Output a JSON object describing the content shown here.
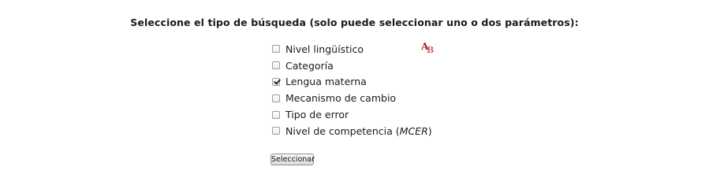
{
  "heading": "Seleccione el tipo de búsqueda (solo puede seleccionar uno o dos parámetros):",
  "options": [
    {
      "label": "Nivel lingüístico",
      "checked": false
    },
    {
      "label": "Categoría",
      "checked": false
    },
    {
      "label": "Lengua materna",
      "checked": true
    },
    {
      "label": "Mecanismo de cambio",
      "checked": false
    },
    {
      "label": "Tipo de error",
      "checked": false
    },
    {
      "label_prefix": "Nivel de competencia (",
      "label_italic": "MCER",
      "label_suffix": ")",
      "checked": false
    }
  ],
  "submit_label": "Seleccionar",
  "decoration": {
    "icon": "ab-logo-icon",
    "color": "#b3262e"
  }
}
